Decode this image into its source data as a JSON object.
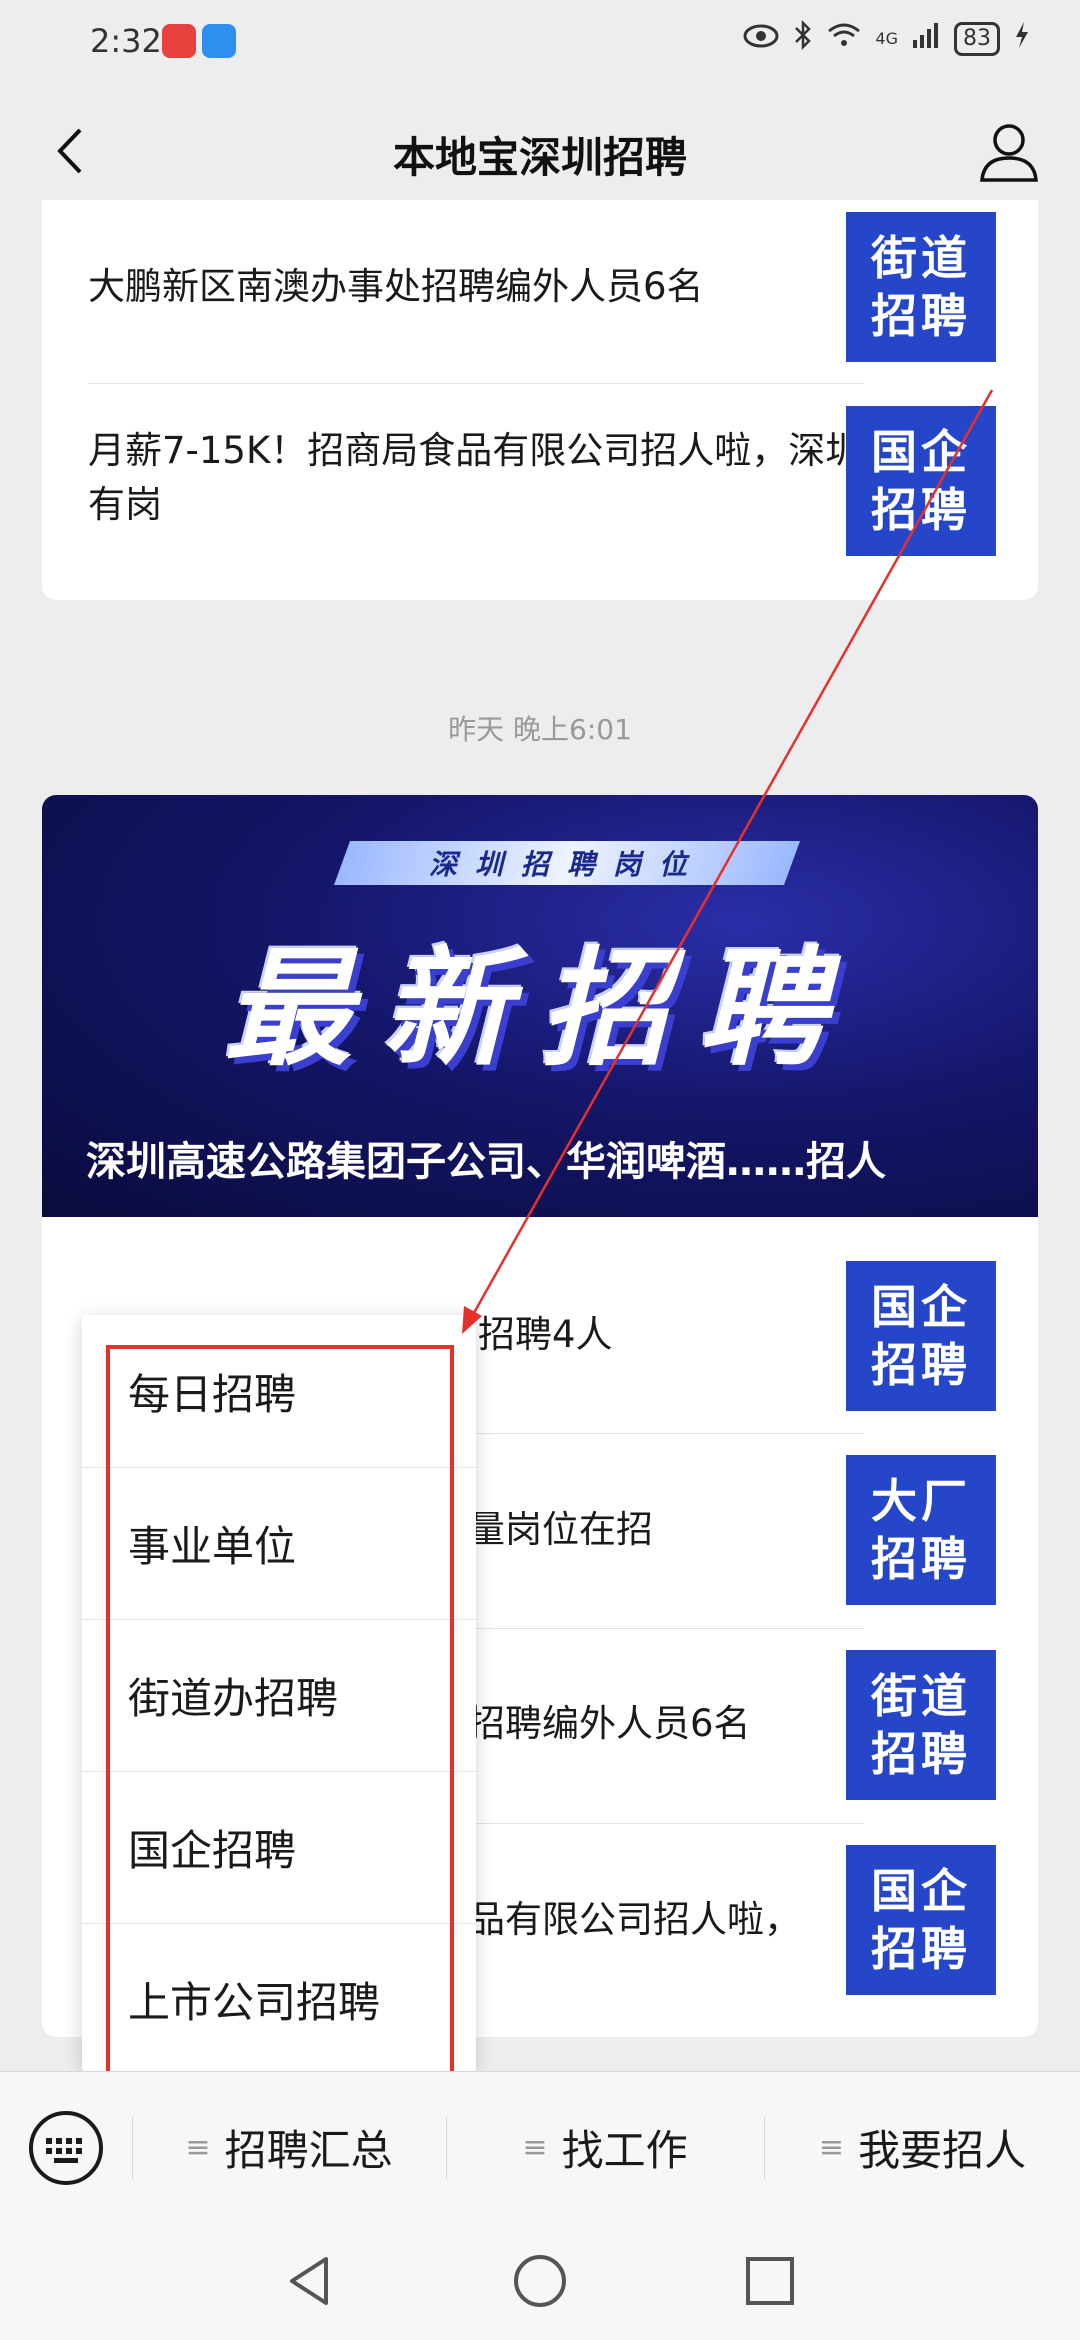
{
  "status_bar": {
    "time": "2:32",
    "battery": "83",
    "network": "4G",
    "icons": [
      "huawei-app-icon",
      "weather-app-icon",
      "eye-icon",
      "bluetooth-icon",
      "wifi-icon",
      "signal-icon",
      "battery-icon",
      "charging-icon"
    ]
  },
  "header": {
    "title": "本地宝深圳招聘",
    "back_icon": "chevron-left-icon",
    "profile_icon": "person-icon"
  },
  "top_card": {
    "articles": [
      {
        "title": "大鹏新区南澳办事处招聘编外人员6名",
        "thumb": "街道\n招聘"
      },
      {
        "title": "月薪7-15K！招商局食品有限公司招人啦，深圳有岗",
        "thumb": "国企\n招聘"
      }
    ]
  },
  "timestamp": "昨天 晚上6:01",
  "main_card": {
    "banner": {
      "tag": "深圳招聘岗位",
      "headline": "最新招聘",
      "caption": "深圳高速公路集团子公司、华润啤酒……招人"
    },
    "articles": [
      {
        "title_visible": "招聘4人",
        "thumb": "国企\n招聘"
      },
      {
        "title_visible": "量岗位在招",
        "thumb": "大厂\n招聘"
      },
      {
        "title_visible": "招聘编外人员6名",
        "thumb": "街道\n招聘"
      },
      {
        "title_visible": "品有限公司招人啦，",
        "thumb": "国企\n招聘"
      }
    ]
  },
  "popup_menu": {
    "items": [
      "每日招聘",
      "事业单位",
      "街道办招聘",
      "国企招聘",
      "上市公司招聘"
    ]
  },
  "bottom_menu": {
    "keyboard_icon": "keyboard-icon",
    "tabs": [
      "招聘汇总",
      "找工作",
      "我要招人"
    ]
  },
  "nav": {
    "icons": [
      "nav-back-icon",
      "nav-home-icon",
      "nav-recents-icon"
    ]
  },
  "colors": {
    "thumb_blue": "#2546c9",
    "highlight_red": "#e8302a",
    "banner_dark": "#14166a"
  }
}
